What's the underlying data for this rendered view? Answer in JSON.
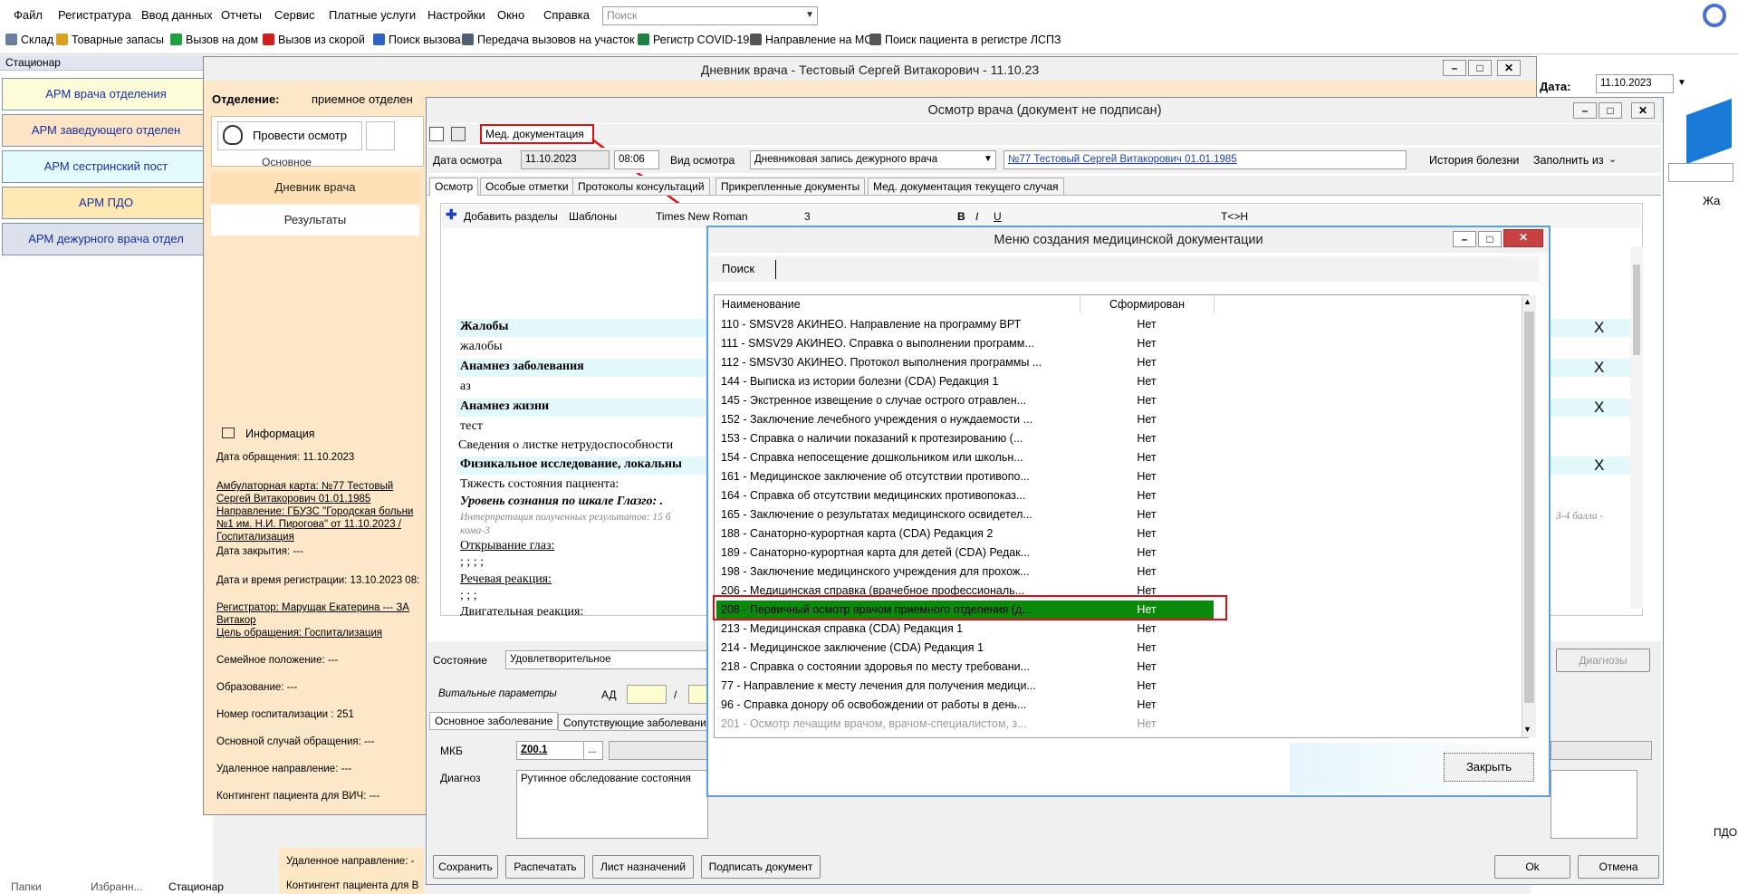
{
  "menubar": {
    "items": [
      "Файл",
      "Регистратура",
      "Ввод данных",
      "Отчеты",
      "Сервис",
      "Платные услуги",
      "Настройки",
      "Окно",
      "Справка"
    ],
    "search_placeholder": "Поиск"
  },
  "toolbar": {
    "items": [
      "Склад",
      "Товарные запасы",
      "Вызов на дом",
      "Вызов из скорой",
      "Поиск вызова",
      "Передача вызовов на участок",
      "Регистр COVID-19",
      "Направление на МСЭ",
      "Поиск пациента в регистре ЛСПЗ"
    ]
  },
  "left": {
    "header": "Стационар",
    "arms": [
      "АРМ врача отделения",
      "АРМ заведующего отделен",
      "АРМ сестринский пост",
      "АРМ ПДО",
      "АРМ дежурного врача отдел"
    ],
    "bottom_tabs": [
      "Папки",
      "Избранн...",
      "Стационар"
    ]
  },
  "right": {
    "date_label": "Дата:",
    "date_value": "11.10.2023",
    "col_label": "Жа",
    "pdo": "ПДО"
  },
  "win1": {
    "title": "Дневник врача - Тестовый Сергей Витакорович - 11.10.23",
    "otd_label": "Отделение:",
    "otd_value": "приемное отделен",
    "exam_button": "Провести осмотр",
    "basic_label": "Основное",
    "nav": [
      "Дневник врача",
      "Результаты"
    ],
    "info_title": "Информация",
    "info_lines": [
      "Дата обращения: 11.10.2023",
      "Амбулаторная карта: №77 Тестовый",
      "Сергей Витакорович 01.01.1985",
      "Направление: ГБУЗС \"Городская больни",
      "№1 им. Н.И. Пирогова\" от 11.10.2023 /",
      "Госпитализация",
      "Дата закрытия: ---",
      "Дата и время регистрации: 13.10.2023 08:",
      "Регистратор: Марущак Екатерина --- ЗА",
      "Витакор",
      "Цель обращения: Госпитализация",
      "Семейное положение: ---",
      "Образование: ---",
      "Номер госпитализации : 251",
      "Основной случай обращения: ---",
      "Удаленное направление: ---",
      "Контингент пациента для ВИЧ: ---"
    ],
    "bottom_lines": [
      "Удаленное направление: -",
      "Контингент пациента для В"
    ]
  },
  "win2": {
    "title": "Осмотр врача (документ не подписан)",
    "meddoc_button": "Мед. документация",
    "date_label": "Дата осмотра",
    "date_value": "11.10.2023",
    "time_value": "08:06",
    "type_label": "Вид осмотра",
    "type_value": "Дневниковая запись дежурного врача",
    "patient_link": "№77 Тестовый Сергей Витакорович 01.01.1985",
    "history": "История болезни",
    "fill_from": "Заполнить из",
    "tabs": [
      "Осмотр",
      "Особые отметки",
      "Протоколы консультаций",
      "Прикрепленные документы",
      "Мед. документация текущего случая"
    ],
    "editor_toolbar": {
      "add_sections": "Добавить разделы",
      "templates": "Шаблоны",
      "font": "Times New Roman",
      "size": "3",
      "tch": "T<>H"
    },
    "editor_lines": [
      {
        "text": "Жалобы",
        "style": "h"
      },
      {
        "text": "жалобы",
        "style": "n"
      },
      {
        "text": "Анамнез заболевания",
        "style": "h"
      },
      {
        "text": "аз",
        "style": "n"
      },
      {
        "text": "Анамнез жизни",
        "style": "h"
      },
      {
        "text": "тест",
        "style": "n"
      },
      {
        "text": "Сведения о листке нетрудоспособности",
        "style": "n"
      },
      {
        "text": "Физикальное исследование, локальны",
        "style": "h"
      },
      {
        "text": "Тяжесть состояния пациента:",
        "style": "n"
      },
      {
        "text": "Уровень сознания по шкале Глазго: .",
        "style": "bi"
      },
      {
        "text": "Интерпретация полученных результатов: 15 б",
        "style": "gi"
      },
      {
        "text": "кома-3",
        "style": "gi"
      },
      {
        "text": "Открывание глаз:",
        "style": "u"
      },
      {
        "text": "; ; ; ;",
        "style": "n"
      },
      {
        "text": "Речевая реакция:",
        "style": "u"
      },
      {
        "text": "; ; ;",
        "style": "n"
      },
      {
        "text": "Двигательная реакция:",
        "style": "u"
      }
    ],
    "editor_right_note": "3-4 балла -",
    "close_x": "X",
    "state_label": "Состояние",
    "state_value": "Удовлетворительное",
    "diagnoses_button": "Диагнозы",
    "vitals_label": "Витальные параметры",
    "ad_label": "АД",
    "slash": "/",
    "diag_tabs": [
      "Основное заболевание",
      "Сопутствующие заболевания"
    ],
    "mkb_label": "МКБ",
    "mkb_value": "Z00.1",
    "ellipsis": "...",
    "diag_label": "Диагноз",
    "diag_value": "Рутинное обследование состояния",
    "buttons": [
      "Сохранить",
      "Распечатать",
      "Лист назначений",
      "Подписать документ"
    ],
    "ok": "Ok",
    "cancel": "Отмена"
  },
  "dialog": {
    "title": "Меню создания медицинской документации",
    "search_label": "Поиск",
    "columns": [
      "Наименование",
      "Сформирован"
    ],
    "rows": [
      {
        "name": "110 - SMSV28 АКИНЕО. Направление на программу ВРТ",
        "status": "Нет"
      },
      {
        "name": "111 - SMSV29 АКИНЕО. Справка о выполнении программ...",
        "status": "Нет"
      },
      {
        "name": "112 - SMSV30 АКИНЕО. Протокол выполнения программы ...",
        "status": "Нет"
      },
      {
        "name": "144 -  Выписка из истории болезни (CDA) Редакция 1",
        "status": "Нет"
      },
      {
        "name": "145 - Экстренное извещение о случае острого отравлен...",
        "status": "Нет"
      },
      {
        "name": "152 - Заключение лечебного учреждения о нуждаемости ...",
        "status": "Нет"
      },
      {
        "name": "153 - Справка о наличии показаний к протезированию (...",
        "status": "Нет"
      },
      {
        "name": "154 - Справка непосещение дошкольником или школьн...",
        "status": "Нет"
      },
      {
        "name": "161 - Медицинское заключение об отсутствии противопо...",
        "status": "Нет"
      },
      {
        "name": "164 - Справка об отсутствии медицинских противопоказ...",
        "status": "Нет"
      },
      {
        "name": "165 - Заключение о результатах медицинского освидетел...",
        "status": "Нет"
      },
      {
        "name": "188 - Санаторно-курортная карта (CDA) Редакция 2",
        "status": "Нет"
      },
      {
        "name": "189 - Санаторно-курортная карта для детей (CDA) Редак...",
        "status": "Нет"
      },
      {
        "name": "198 - Заключение медицинского учреждения для прохож...",
        "status": "Нет"
      },
      {
        "name": "206 - Медицинская справка (врачебное профессиональ...",
        "status": "Нет"
      },
      {
        "name": "208 - Первичный осмотр врачом приемного отделения (д...",
        "status": "Нет"
      },
      {
        "name": "213 - Медицинская справка (CDA) Редакция 1",
        "status": "Нет"
      },
      {
        "name": "214 - Медицинское заключение (CDA) Редакция 1",
        "status": "Нет"
      },
      {
        "name": "218 - Справка о состоянии здоровья по месту требовани...",
        "status": "Нет"
      },
      {
        "name": "77 - Направление к месту лечения для получения медици...",
        "status": "Нет"
      },
      {
        "name": "96 - Справка донору об освобождении от работы в день...",
        "status": "Нет"
      },
      {
        "name": "201 - Осмотр лечащим врачом, врачом-специалистом, з...",
        "status": "Нет"
      }
    ],
    "selected_index": 15,
    "close_button": "Закрыть"
  },
  "colors": {
    "accent": "#1830a0",
    "highlight_red": "#e01010",
    "selected_green": "#0a8a0a",
    "row_cyan": "#e2f8fb"
  }
}
